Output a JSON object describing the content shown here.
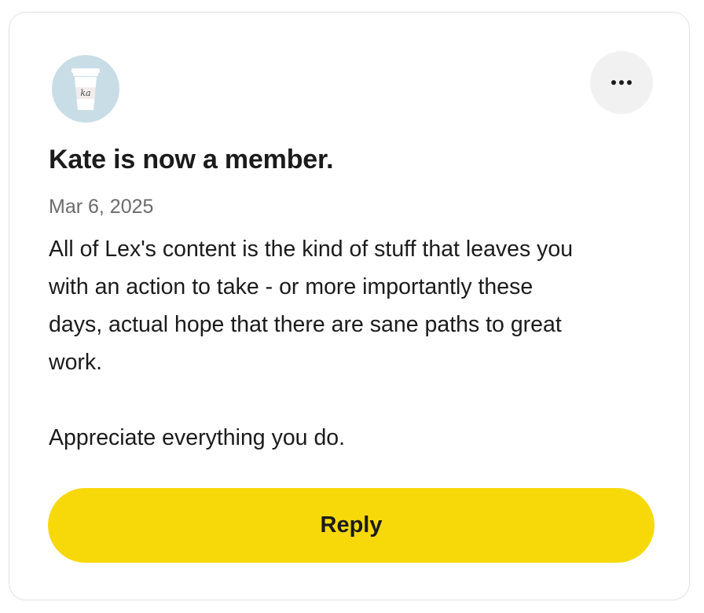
{
  "post": {
    "avatar_icon": "coffee-cup-avatar-icon",
    "avatar_initials": "ka",
    "more_icon": "ellipsis-icon",
    "title": "Kate is now a member.",
    "date": "Mar 6, 2025",
    "body_lines": [
      "All of Lex's content is the kind of stuff that leaves you",
      "with an action to take - or more importantly these",
      "days, actual hope that there are sane paths to great",
      "work.",
      "Appreciate everything you do."
    ],
    "reply_label": "Reply"
  },
  "colors": {
    "avatar_bg": "#c8dde6",
    "reply_bg": "#f7d90a",
    "more_bg": "#f1f1f1",
    "text": "#1b1b1b",
    "muted": "#6b6b6b"
  }
}
